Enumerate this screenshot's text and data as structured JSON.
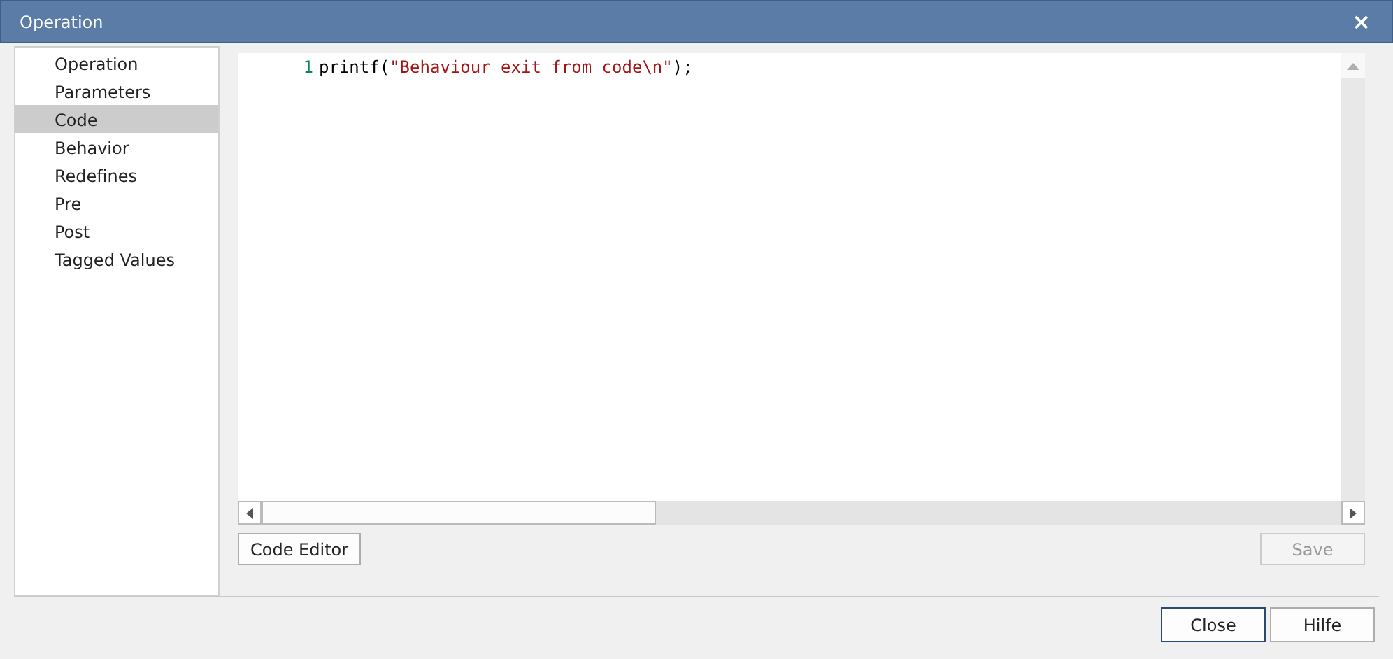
{
  "window": {
    "title": "Operation",
    "close": "×"
  },
  "sidebar": {
    "items": [
      {
        "label": "Operation",
        "selected": false
      },
      {
        "label": "Parameters",
        "selected": false
      },
      {
        "label": "Code",
        "selected": true
      },
      {
        "label": "Behavior",
        "selected": false
      },
      {
        "label": "Redefines",
        "selected": false
      },
      {
        "label": "Pre",
        "selected": false
      },
      {
        "label": "Post",
        "selected": false
      },
      {
        "label": "Tagged Values",
        "selected": false
      }
    ]
  },
  "editor": {
    "lines": [
      {
        "number": "1",
        "tokens": [
          {
            "kind": "plain",
            "text": "printf("
          },
          {
            "kind": "string",
            "text": "\"Behaviour exit from code\\n\""
          },
          {
            "kind": "plain",
            "text": ");"
          }
        ]
      }
    ]
  },
  "buttons": [
    {
      "label": "Code Editor",
      "disabled": false
    },
    {
      "label": "Save",
      "disabled": true
    }
  ],
  "footer_buttons": [
    {
      "label": "Close",
      "default": true
    },
    {
      "label": "Hilfe",
      "default": false
    }
  ]
}
